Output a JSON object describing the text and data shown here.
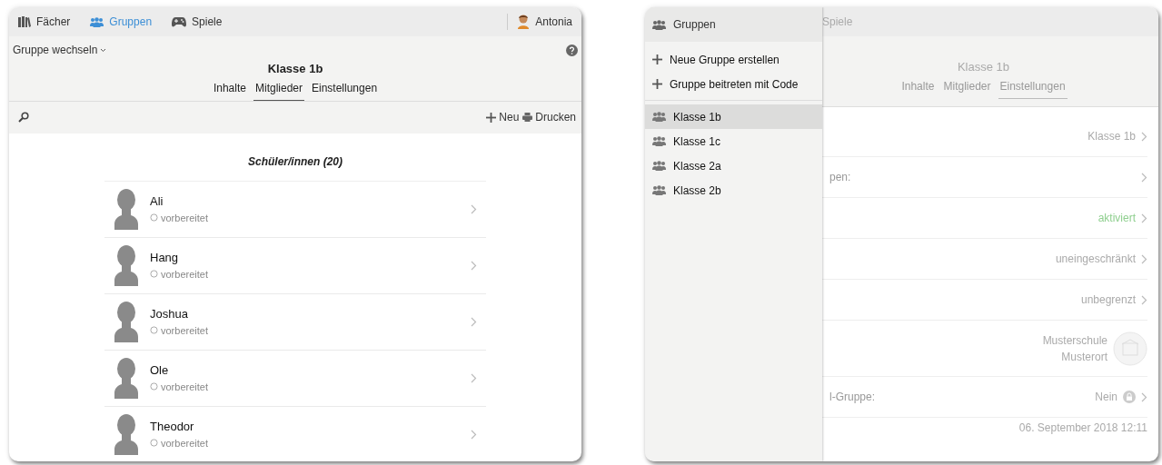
{
  "left_screen": {
    "nav": {
      "items": [
        {
          "label": "Fächer",
          "selected": false
        },
        {
          "label": "Gruppen",
          "selected": true
        },
        {
          "label": "Spiele",
          "selected": false
        }
      ],
      "user": "Antonia"
    },
    "group_switch": "Gruppe wechseln",
    "title": "Klasse 1b",
    "tabs": [
      {
        "label": "Inhalte",
        "selected": false
      },
      {
        "label": "Mitglieder",
        "selected": true
      },
      {
        "label": "Einstellungen",
        "selected": false
      }
    ],
    "toolbar": {
      "new": "Neu",
      "print": "Drucken"
    },
    "section_title": "Schüler/innen (20)",
    "members": [
      {
        "name": "Ali",
        "status": "vorbereitet"
      },
      {
        "name": "Hang",
        "status": "vorbereitet"
      },
      {
        "name": "Joshua",
        "status": "vorbereitet"
      },
      {
        "name": "Ole",
        "status": "vorbereitet"
      },
      {
        "name": "Theodor",
        "status": "vorbereitet"
      }
    ]
  },
  "right_screen": {
    "menu": {
      "title": "Gruppen",
      "actions": [
        "Neue Gruppe erstellen",
        "Gruppe beitreten mit Code"
      ],
      "groups": [
        {
          "label": "Klasse 1b",
          "selected": true
        },
        {
          "label": "Klasse 1c",
          "selected": false
        },
        {
          "label": "Klasse 2a",
          "selected": false
        },
        {
          "label": "Klasse 2b",
          "selected": false
        }
      ]
    },
    "background": {
      "nav_item": "Spiele",
      "title": "Klasse 1b",
      "tabs": [
        {
          "label": "Inhalte",
          "selected": false
        },
        {
          "label": "Mitglieder",
          "selected": false
        },
        {
          "label": "Einstellungen",
          "selected": true
        }
      ],
      "settings": [
        {
          "kind": "value",
          "value": "Klasse 1b"
        },
        {
          "kind": "label",
          "label": "pen:"
        },
        {
          "kind": "active",
          "value": "aktiviert"
        },
        {
          "kind": "value",
          "value": "uneingeschränkt"
        },
        {
          "kind": "value",
          "value": "unbegrenzt"
        },
        {
          "kind": "school",
          "value_lines": [
            "Musterschule",
            "Musterort"
          ]
        },
        {
          "kind": "lock",
          "label": "l-Gruppe:",
          "value": "Nein"
        },
        {
          "kind": "date",
          "value": "06. September 2018 12:11"
        }
      ]
    }
  }
}
